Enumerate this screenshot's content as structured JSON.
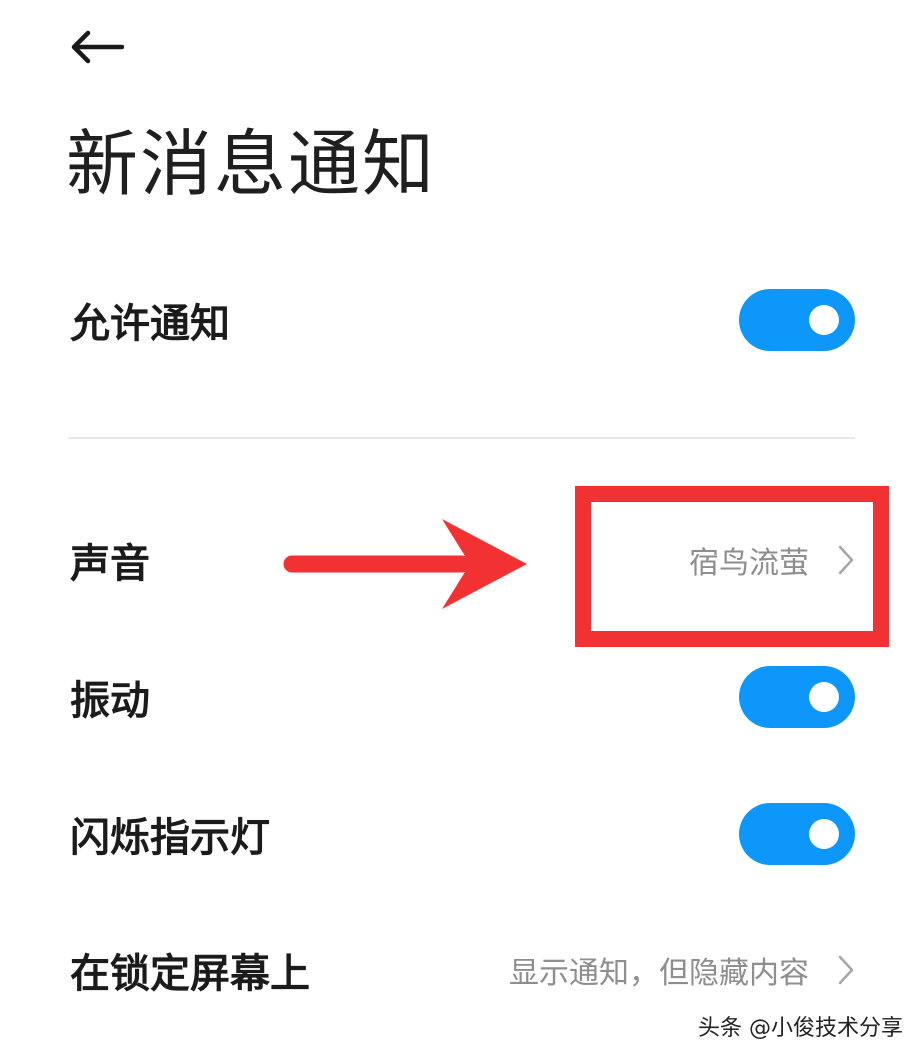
{
  "header": {
    "title": "新消息通知"
  },
  "settings": {
    "allow_notifications": {
      "label": "允许通知",
      "enabled": true
    },
    "sound": {
      "label": "声音",
      "value": "宿鸟流萤"
    },
    "vibration": {
      "label": "振动",
      "enabled": true
    },
    "indicator_light": {
      "label": "闪烁指示灯",
      "enabled": true
    },
    "lock_screen": {
      "label": "在锁定屏幕上",
      "value": "显示通知，但隐藏内容"
    }
  },
  "annotation": {
    "color": "#f23232"
  },
  "watermark": {
    "text": "头条 @小俊技术分享"
  },
  "colors": {
    "toggle_on": "#0d97fb",
    "secondary_text": "#8e8e8e"
  },
  "icons": {
    "back": "arrow-left-icon",
    "chevron": "chevron-right-icon"
  }
}
